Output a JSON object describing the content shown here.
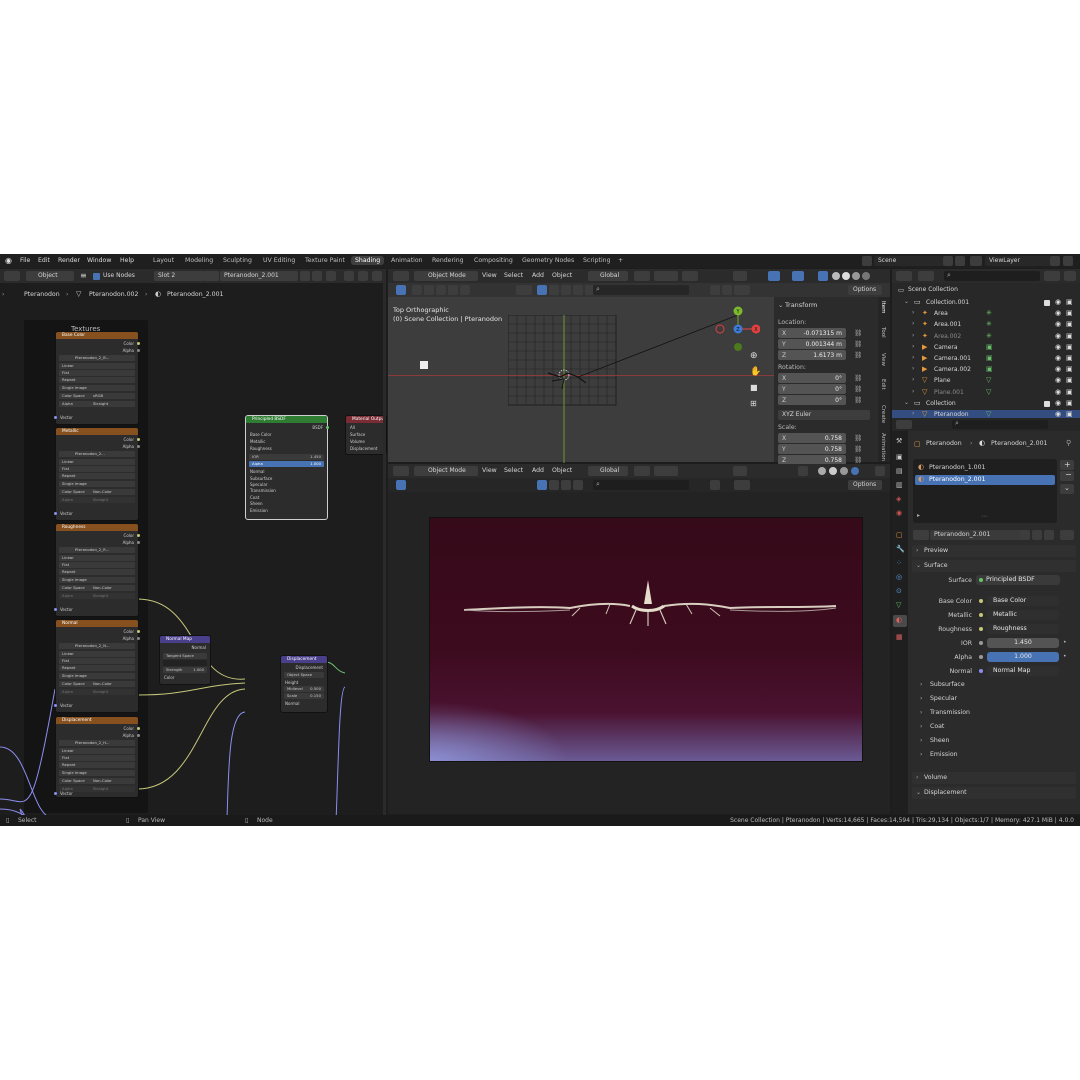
{
  "menus": [
    "File",
    "Edit",
    "Render",
    "Window",
    "Help"
  ],
  "workspaces": [
    "Layout",
    "Modeling",
    "Sculpting",
    "UV Editing",
    "Texture Paint",
    "Shading",
    "Animation",
    "Rendering",
    "Compositing",
    "Geometry Nodes",
    "Scripting",
    "+"
  ],
  "active_workspace": "Shading",
  "scene": "Scene",
  "view_layer": "ViewLayer",
  "node_editor": {
    "mode": "Object",
    "use_nodes": "Use Nodes",
    "slot": "Slot 2",
    "material": "Pteranodon_2.001",
    "breadcrumb": [
      "Pteranodon",
      "Pteranodon.002",
      "Pteranodon_2.001"
    ],
    "frame_label": "Textures",
    "texture_nodes": [
      {
        "title": "Base Color",
        "image": "Pteranodon_2_B...",
        "space": "sRGB",
        "alpha": "Straight"
      },
      {
        "title": "Metallic",
        "image": "Pteranodon_2...",
        "space": "Non-Color",
        "alpha": "Straight"
      },
      {
        "title": "Roughness",
        "image": "Pteranodon_2_R...",
        "space": "Non-Color",
        "alpha": "Straight"
      },
      {
        "title": "Normal",
        "image": "Pteranodon_2_N...",
        "space": "Non-Color",
        "alpha": "Straight"
      },
      {
        "title": "Displacement",
        "image": "Pteranodon_2_H...",
        "space": "Non-Color",
        "alpha": "Straight"
      }
    ],
    "tex_rows": {
      "interp": "Linear",
      "proj": "Flat",
      "ext": "Repeat",
      "src": "Single Image",
      "cs_label": "Color Space",
      "alpha_label": "Alpha",
      "vector": "Vector",
      "color": "Color",
      "alpha": "Alpha"
    },
    "bsdf": {
      "title": "Principled BSDF",
      "out": "BSDF",
      "inputs": [
        "Base Color",
        "Metallic",
        "Roughness"
      ],
      "ior_label": "IOR",
      "ior": "1.450",
      "alpha_label": "Alpha",
      "alpha": "1.000",
      "normal": "Normal",
      "subs": [
        "Subsurface",
        "Specular",
        "Transmission",
        "Coat",
        "Sheen",
        "Emission"
      ]
    },
    "output": {
      "title": "Material Output",
      "target": "All",
      "inputs": [
        "Surface",
        "Volume",
        "Displacement"
      ]
    },
    "normal_map": {
      "title": "Normal Map",
      "out": "Normal",
      "space": "Tangent Space",
      "strength_label": "Strength",
      "strength": "1.000",
      "color": "Color"
    },
    "displacement": {
      "title": "Displacement",
      "out": "Displacement",
      "space": "Object Space",
      "height": "Height",
      "midlevel_label": "Midlevel",
      "midlevel": "0.500",
      "scale_label": "Scale",
      "scale": "0.150",
      "normal": "Normal"
    }
  },
  "viewport_top": {
    "mode": "Object Mode",
    "menu": [
      "View",
      "Select",
      "Add",
      "Object"
    ],
    "orient": "Global",
    "options": "Options",
    "view_name": "Top Orthographic",
    "collection_info": "(0) Scene Collection | Pteranodon",
    "transform_title": "Transform",
    "location_label": "Location:",
    "location": [
      {
        "axis": "X",
        "value": "-0.071315 m"
      },
      {
        "axis": "Y",
        "value": "0.001344 m"
      },
      {
        "axis": "Z",
        "value": "1.6173 m"
      }
    ],
    "rotation_label": "Rotation:",
    "rotation": [
      {
        "axis": "X",
        "value": "0°"
      },
      {
        "axis": "Y",
        "value": "0°"
      },
      {
        "axis": "Z",
        "value": "0°"
      }
    ],
    "rotation_mode": "XYZ Euler",
    "scale_label": "Scale:",
    "scale": [
      {
        "axis": "X",
        "value": "0.758"
      },
      {
        "axis": "Y",
        "value": "0.758"
      },
      {
        "axis": "Z",
        "value": "0.758"
      }
    ],
    "side_tabs": [
      "Item",
      "Tool",
      "View",
      "Edit",
      "Create",
      "Animation"
    ]
  },
  "viewport_bottom": {
    "mode": "Object Mode",
    "menu": [
      "View",
      "Select",
      "Add",
      "Object"
    ],
    "orient": "Global",
    "options": "Options"
  },
  "outliner": {
    "root": "Scene Collection",
    "items": [
      {
        "name": "Collection.001",
        "level": 1,
        "type": "collection"
      },
      {
        "name": "Area",
        "level": 2,
        "type": "light"
      },
      {
        "name": "Area.001",
        "level": 2,
        "type": "light"
      },
      {
        "name": "Area.002",
        "level": 2,
        "type": "light",
        "dim": true
      },
      {
        "name": "Camera",
        "level": 2,
        "type": "camera"
      },
      {
        "name": "Camera.001",
        "level": 2,
        "type": "camera"
      },
      {
        "name": "Camera.002",
        "level": 2,
        "type": "camera"
      },
      {
        "name": "Plane",
        "level": 2,
        "type": "mesh"
      },
      {
        "name": "Plane.001",
        "level": 2,
        "type": "mesh",
        "dim": true
      },
      {
        "name": "Collection",
        "level": 1,
        "type": "collection"
      },
      {
        "name": "Pteranodon",
        "level": 2,
        "type": "mesh",
        "selected": true
      }
    ]
  },
  "properties": {
    "breadcrumb": [
      "Pteranodon",
      "Pteranodon_2.001"
    ],
    "slots": [
      "Pteranodon_1.001",
      "Pteranodon_2.001"
    ],
    "material": "Pteranodon_2.001",
    "preview": "Preview",
    "surface_section": "Surface",
    "surface_label": "Surface",
    "surface_value": "Principled BSDF",
    "rows": [
      {
        "label": "Base Color",
        "value": "Base Color"
      },
      {
        "label": "Metallic",
        "value": "Metallic"
      },
      {
        "label": "Roughness",
        "value": "Roughness"
      },
      {
        "label": "IOR",
        "value": "1.450"
      },
      {
        "label": "Alpha",
        "value": "1.000"
      },
      {
        "label": "Normal",
        "value": "Normal Map"
      }
    ],
    "subsections": [
      "Subsurface",
      "Specular",
      "Transmission",
      "Coat",
      "Sheen",
      "Emission"
    ],
    "volume": "Volume",
    "displacement": "Displacement"
  },
  "statusbar": {
    "select": "Select",
    "pan": "Pan View",
    "node": "Node",
    "info": "Scene Collection | Pteranodon | Verts:14,665 | Faces:14,594 | Tris:29,134 | Objects:1/7 | Memory: 427.1 MiB | 4.0.0"
  },
  "colors": {
    "accent": "#4772b3",
    "texture_header": "#86501f",
    "bsdf_header": "#2e7d32",
    "output_header": "#7a2c34",
    "vector_header": "#4a3f8a",
    "render_bg": "#3a0d1c"
  }
}
